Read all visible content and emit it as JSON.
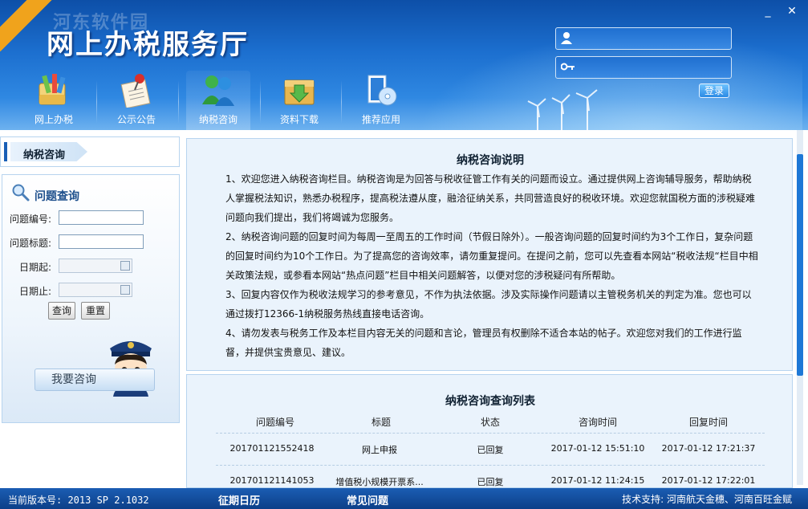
{
  "header": {
    "watermark": "河东软件园",
    "corner_ribbon": "",
    "title": "网上办税服务厅",
    "win_min": "_",
    "win_close": "✕",
    "nav": [
      {
        "label": "网上办税",
        "icon": "tax-office-icon"
      },
      {
        "label": "公示公告",
        "icon": "notice-pin-icon"
      },
      {
        "label": "纳税咨询",
        "icon": "consult-people-icon",
        "active": true
      },
      {
        "label": "资料下载",
        "icon": "download-box-icon"
      },
      {
        "label": "推荐应用",
        "icon": "app-cd-icon"
      }
    ],
    "login": {
      "username_placeholder": "",
      "password_placeholder": "",
      "button": "登录"
    }
  },
  "sidebar": {
    "section_title": "纳税咨询",
    "query": {
      "title": "问题查询",
      "fields": {
        "number_label": "问题编号:",
        "title_label": "问题标题:",
        "date_start_label": "日期起:",
        "date_end_label": "日期止:"
      },
      "search_button": "查询",
      "reset_button": "重置"
    },
    "consult_button": "我要咨询"
  },
  "info": {
    "title": "纳税咨询说明",
    "paragraphs": [
      "1、欢迎您进入纳税咨询栏目。纳税咨询是为回答与税收征管工作有关的问题而设立。通过提供网上咨询辅导服务，帮助纳税人掌握税法知识，熟悉办税程序，提高税法遵从度，融洽征纳关系，共同营造良好的税收环境。欢迎您就国税方面的涉税疑难问题向我们提出，我们将竭诚为您服务。",
      "2、纳税咨询问题的回复时间为每周一至周五的工作时间（节假日除外）。一般咨询问题的回复时间约为3个工作日，复杂问题的回复时间约为10个工作日。为了提高您的咨询效率，请勿重复提问。在提问之前，您可以先查看本网站“税收法规“栏目中相关政策法规，或参看本网站“热点问题”栏目中相关问题解答，以便对您的涉税疑问有所帮助。",
      "3、回复内容仅作为税收法规学习的参考意见，不作为执法依据。涉及实际操作问题请以主管税务机关的判定为准。您也可以通过拨打12366-1纳税服务热线直接电话咨询。",
      "4、请勿发表与税务工作及本栏目内容无关的问题和言论，管理员有权删除不适合本站的帖子。欢迎您对我们的工作进行监督，并提供宝贵意见、建议。"
    ]
  },
  "list": {
    "title": "纳税咨询查询列表",
    "columns": [
      "问题编号",
      "标题",
      "状态",
      "咨询时间",
      "回复时间"
    ],
    "rows": [
      [
        "201701121552418",
        "网上申报",
        "已回复",
        "2017-01-12 15:51:10",
        "2017-01-12 17:21:37"
      ],
      [
        "201701121141053",
        "增值税小规模开票系...",
        "已回复",
        "2017-01-12 11:24:15",
        "2017-01-12 17:22:01"
      ]
    ]
  },
  "status": {
    "version": "当前版本号: 2013 SP 2.1032",
    "link_calendar": "征期日历",
    "link_faq": "常见问题",
    "support": "技术支持: 河南航天金穗、河南百旺金赋"
  }
}
